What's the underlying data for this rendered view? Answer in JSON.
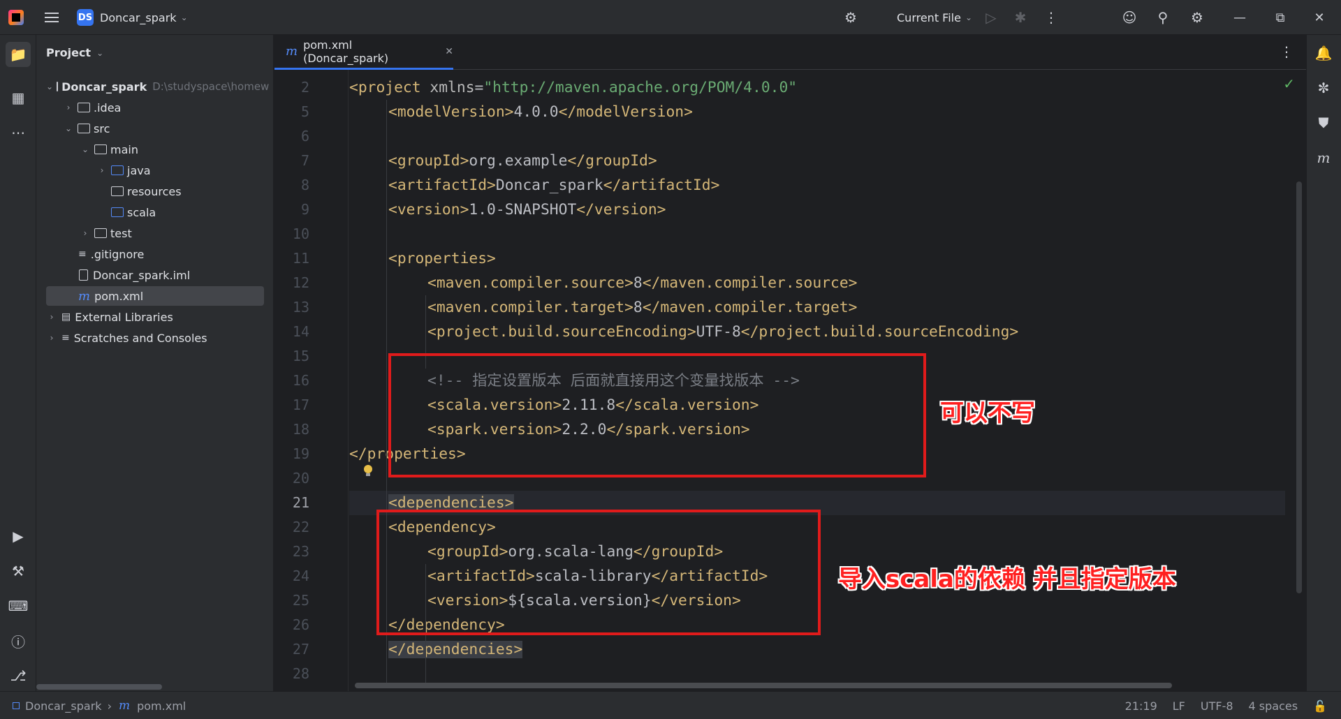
{
  "titlebar": {
    "project_badge": "DS",
    "project_name": "Doncar_spark",
    "run_config": "Current File"
  },
  "project_panel": {
    "title": "Project",
    "tree": [
      {
        "label": "Doncar_spark",
        "path": "D:\\studyspace\\homew",
        "type": "root"
      },
      {
        "label": ".idea",
        "type": "folder"
      },
      {
        "label": "src",
        "type": "folder"
      },
      {
        "label": "main",
        "type": "folder"
      },
      {
        "label": "java",
        "type": "source-folder"
      },
      {
        "label": "resources",
        "type": "resources-folder"
      },
      {
        "label": "scala",
        "type": "source-folder"
      },
      {
        "label": "test",
        "type": "folder"
      },
      {
        "label": ".gitignore",
        "type": "text-file"
      },
      {
        "label": "Doncar_spark.iml",
        "type": "iml-file"
      },
      {
        "label": "pom.xml",
        "type": "maven-file"
      },
      {
        "label": "External Libraries",
        "type": "libraries"
      },
      {
        "label": "Scratches and Consoles",
        "type": "scratches"
      }
    ]
  },
  "editor": {
    "tab_label": "pom.xml (Doncar_spark)",
    "tab_icon": "m",
    "line_numbers": [
      "2",
      "5",
      "6",
      "7",
      "8",
      "9",
      "10",
      "11",
      "12",
      "13",
      "14",
      "15",
      "16",
      "17",
      "18",
      "19",
      "20",
      "21",
      "22",
      "23",
      "24",
      "25",
      "26",
      "27",
      "28"
    ],
    "current_line": "21",
    "lines": [
      {
        "ln": "2",
        "indent": 0,
        "parts": [
          [
            "tag",
            "<project "
          ],
          [
            "attr",
            "xmlns"
          ],
          [
            "txt",
            "="
          ],
          [
            "str",
            "\"http://maven.apache.org/POM/4.0.0\""
          ]
        ]
      },
      {
        "ln": "5",
        "indent": 1,
        "parts": [
          [
            "tag",
            "<modelVersion>"
          ],
          [
            "txt",
            "4.0.0"
          ],
          [
            "tag",
            "</modelVersion>"
          ]
        ]
      },
      {
        "ln": "6",
        "indent": 0,
        "parts": []
      },
      {
        "ln": "7",
        "indent": 1,
        "parts": [
          [
            "tag",
            "<groupId>"
          ],
          [
            "txt",
            "org.example"
          ],
          [
            "tag",
            "</groupId>"
          ]
        ]
      },
      {
        "ln": "8",
        "indent": 1,
        "parts": [
          [
            "tag",
            "<artifactId>"
          ],
          [
            "txt",
            "Doncar_spark"
          ],
          [
            "tag",
            "</artifactId>"
          ]
        ]
      },
      {
        "ln": "9",
        "indent": 1,
        "parts": [
          [
            "tag",
            "<version>"
          ],
          [
            "txt",
            "1.0-SNAPSHOT"
          ],
          [
            "tag",
            "</version>"
          ]
        ]
      },
      {
        "ln": "10",
        "indent": 0,
        "parts": []
      },
      {
        "ln": "11",
        "indent": 1,
        "parts": [
          [
            "tag",
            "<properties>"
          ]
        ]
      },
      {
        "ln": "12",
        "indent": 2,
        "parts": [
          [
            "tag",
            "<maven.compiler.source>"
          ],
          [
            "txt",
            "8"
          ],
          [
            "tag",
            "</maven.compiler.source>"
          ]
        ]
      },
      {
        "ln": "13",
        "indent": 2,
        "parts": [
          [
            "tag",
            "<maven.compiler.target>"
          ],
          [
            "txt",
            "8"
          ],
          [
            "tag",
            "</maven.compiler.target>"
          ]
        ]
      },
      {
        "ln": "14",
        "indent": 2,
        "parts": [
          [
            "tag",
            "<project.build.sourceEncoding>"
          ],
          [
            "txt",
            "UTF-8"
          ],
          [
            "tag",
            "</project.build.sourceEncoding>"
          ]
        ]
      },
      {
        "ln": "15",
        "indent": 0,
        "parts": []
      },
      {
        "ln": "16",
        "indent": 2,
        "parts": [
          [
            "cmt",
            "<!-- 指定设置版本 后面就直接用这个变量找版本 -->"
          ]
        ]
      },
      {
        "ln": "17",
        "indent": 2,
        "parts": [
          [
            "tag",
            "<scala.version>"
          ],
          [
            "txt",
            "2.11.8"
          ],
          [
            "tag",
            "</scala.version>"
          ]
        ]
      },
      {
        "ln": "18",
        "indent": 2,
        "parts": [
          [
            "tag",
            "<spark.version>"
          ],
          [
            "txt",
            "2.2.0"
          ],
          [
            "tag",
            "</spark.version>"
          ]
        ]
      },
      {
        "ln": "19",
        "indent": 0,
        "parts": [
          [
            "tag",
            "</properties>"
          ]
        ]
      },
      {
        "ln": "20",
        "indent": 0,
        "parts": []
      },
      {
        "ln": "21",
        "indent": 1,
        "parts": [
          [
            "hl",
            "<dependencies>"
          ]
        ]
      },
      {
        "ln": "22",
        "indent": 1,
        "parts": [
          [
            "tag",
            "<dependency>"
          ]
        ]
      },
      {
        "ln": "23",
        "indent": 2,
        "parts": [
          [
            "tag",
            "<groupId>"
          ],
          [
            "txt",
            "org.scala-lang"
          ],
          [
            "tag",
            "</groupId>"
          ]
        ]
      },
      {
        "ln": "24",
        "indent": 2,
        "parts": [
          [
            "tag",
            "<artifactId>"
          ],
          [
            "txt",
            "scala-library"
          ],
          [
            "tag",
            "</artifactId>"
          ]
        ]
      },
      {
        "ln": "25",
        "indent": 2,
        "parts": [
          [
            "tag",
            "<version>"
          ],
          [
            "txt",
            "${scala.version}"
          ],
          [
            "tag",
            "</version>"
          ]
        ]
      },
      {
        "ln": "26",
        "indent": 1,
        "parts": [
          [
            "tag",
            "</dependency>"
          ]
        ]
      },
      {
        "ln": "27",
        "indent": 1,
        "parts": [
          [
            "hl",
            "</dependencies>"
          ]
        ]
      },
      {
        "ln": "28",
        "indent": 0,
        "parts": []
      }
    ]
  },
  "annotations": {
    "note1": "可以不写",
    "note2": "导入scala的依赖 并且指定版本"
  },
  "statusbar": {
    "breadcrumb_project": "Doncar_spark",
    "breadcrumb_file": "pom.xml",
    "position": "21:19",
    "line_sep": "LF",
    "encoding": "UTF-8",
    "indent": "4 spaces"
  },
  "colors": {
    "tag": "#d5b778",
    "string": "#6aab73",
    "comment": "#7a7e85",
    "annotation_red": "#e01b1b",
    "accent": "#3574f0"
  }
}
